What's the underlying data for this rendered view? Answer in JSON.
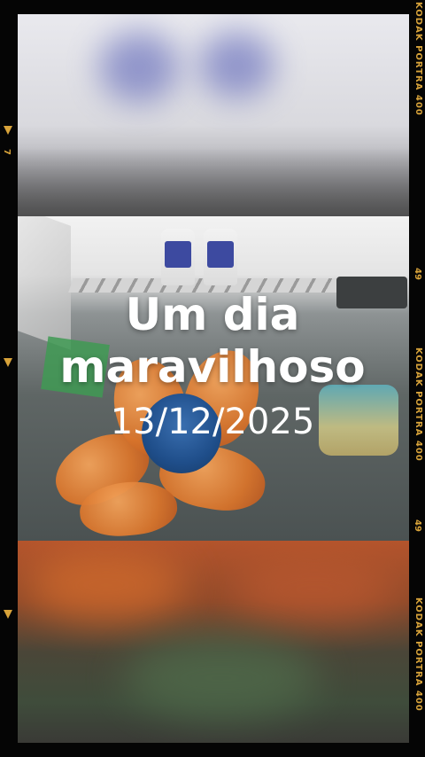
{
  "headline": {
    "line1": "Um dia",
    "line2": "maravilhoso"
  },
  "date": "13/12/2025",
  "film_strip": {
    "brand_label": "KODAK PORTRA 400",
    "frame_number": "49",
    "left_number": "7",
    "edge_color": "#d8a33a"
  }
}
